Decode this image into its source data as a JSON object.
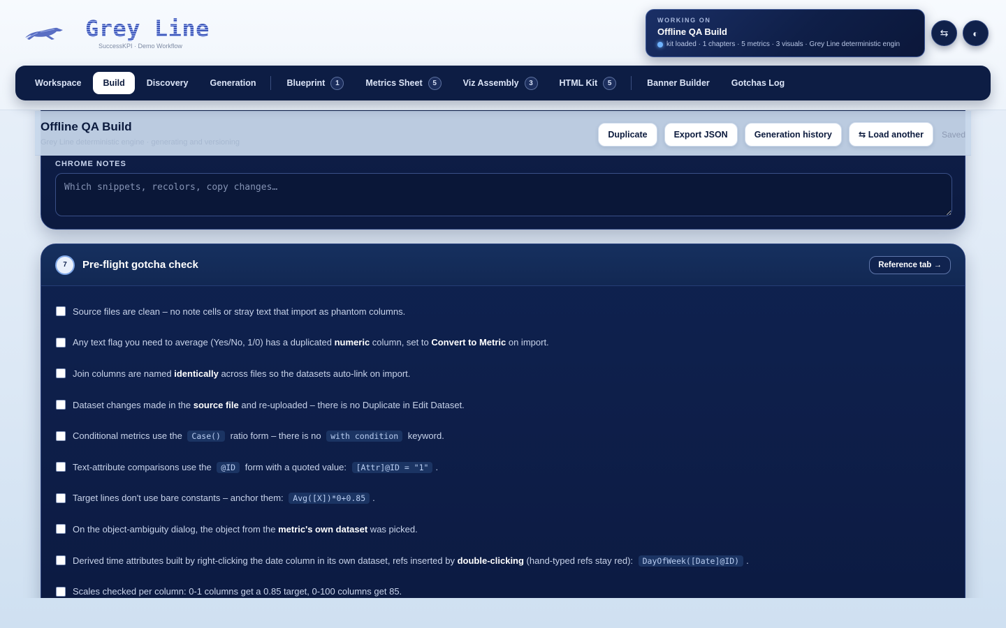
{
  "app": {
    "logo_title": "Grey Line",
    "logo_subtitle": "SuccessKPI · Demo Workflow",
    "logo_icon": "greyhound-icon"
  },
  "working_on": {
    "eyebrow": "WORKING ON",
    "title": "Offline QA Build",
    "status": "kit loaded · 1 chapters · 5 metrics · 3 visuals · Grey Line deterministic engin",
    "status_color": "#6fb3ff"
  },
  "header_buttons": {
    "swap_icon": "⇆",
    "theme_icon": "◐"
  },
  "nav": {
    "tabs": [
      {
        "label": "Workspace"
      },
      {
        "label": "Build"
      },
      {
        "label": "Discovery"
      },
      {
        "label": "Generation"
      },
      {
        "label": "Blueprint",
        "count": "1"
      },
      {
        "label": "Metrics Sheet",
        "count": "5"
      },
      {
        "label": "Viz Assembly",
        "count": "3"
      },
      {
        "label": "HTML Kit",
        "count": "5"
      },
      {
        "label": "Banner Builder"
      },
      {
        "label": "Gotchas Log"
      }
    ],
    "active": "Build"
  },
  "doc": {
    "title": "Offline QA Build",
    "subtitle": "Grey Line deterministic engine · generating and versioning",
    "actions": {
      "duplicate": "Duplicate",
      "export": "Export JSON",
      "history": "Generation history",
      "load": "⇆ Load another"
    },
    "saved": "Saved"
  },
  "chrome_notes": {
    "label": "CHROME NOTES",
    "placeholder": "Which snippets, recolors, copy changes…"
  },
  "preflight": {
    "step": "7",
    "title": "Pre-flight gotcha check",
    "reference_btn": "Reference tab →",
    "items": [
      {
        "t1": "Source files are clean – no note cells or stray text that import as phantom columns."
      },
      {
        "t1": "Any text flag you need to average (Yes/No, 1/0) has a duplicated ",
        "b1": "numeric",
        "t2": " column, set to ",
        "b2": "Convert to Metric",
        "t3": " on import."
      },
      {
        "t1": "Join columns are named ",
        "b1": "identically",
        "t2": " across files so the datasets auto-link on import."
      },
      {
        "t1": "Dataset changes made in the ",
        "b1": "source file",
        "t2": " and re-uploaded – there is no Duplicate in Edit Dataset."
      },
      {
        "t1": "Conditional metrics use the ",
        "c1": "Case()",
        "t2": " ratio form – there is no ",
        "c2": "with condition",
        "t3": " keyword."
      },
      {
        "t1": "Text-attribute comparisons use the ",
        "c1": "@ID",
        "t2": " form with a quoted value: ",
        "c2": "[Attr]@ID = \"1\"",
        "t3": "."
      },
      {
        "t1": "Target lines don't use bare constants – anchor them: ",
        "c1": "Avg([X])*0+0.85",
        "t2": "."
      },
      {
        "t1": "On the object-ambiguity dialog, the object from the ",
        "b1": "metric's own dataset",
        "t2": " was picked."
      },
      {
        "t1": "Derived time attributes built by right-clicking the date column in its own dataset, refs inserted by ",
        "b1": "double-clicking",
        "t2": " (hand-typed refs stay red): ",
        "c1": "DayOfWeek([Date]@ID)",
        "t3": "."
      },
      {
        "t1": "Scales checked per column: 0-1 columns get a 0.85 target, 0-100 columns get 85."
      }
    ]
  }
}
